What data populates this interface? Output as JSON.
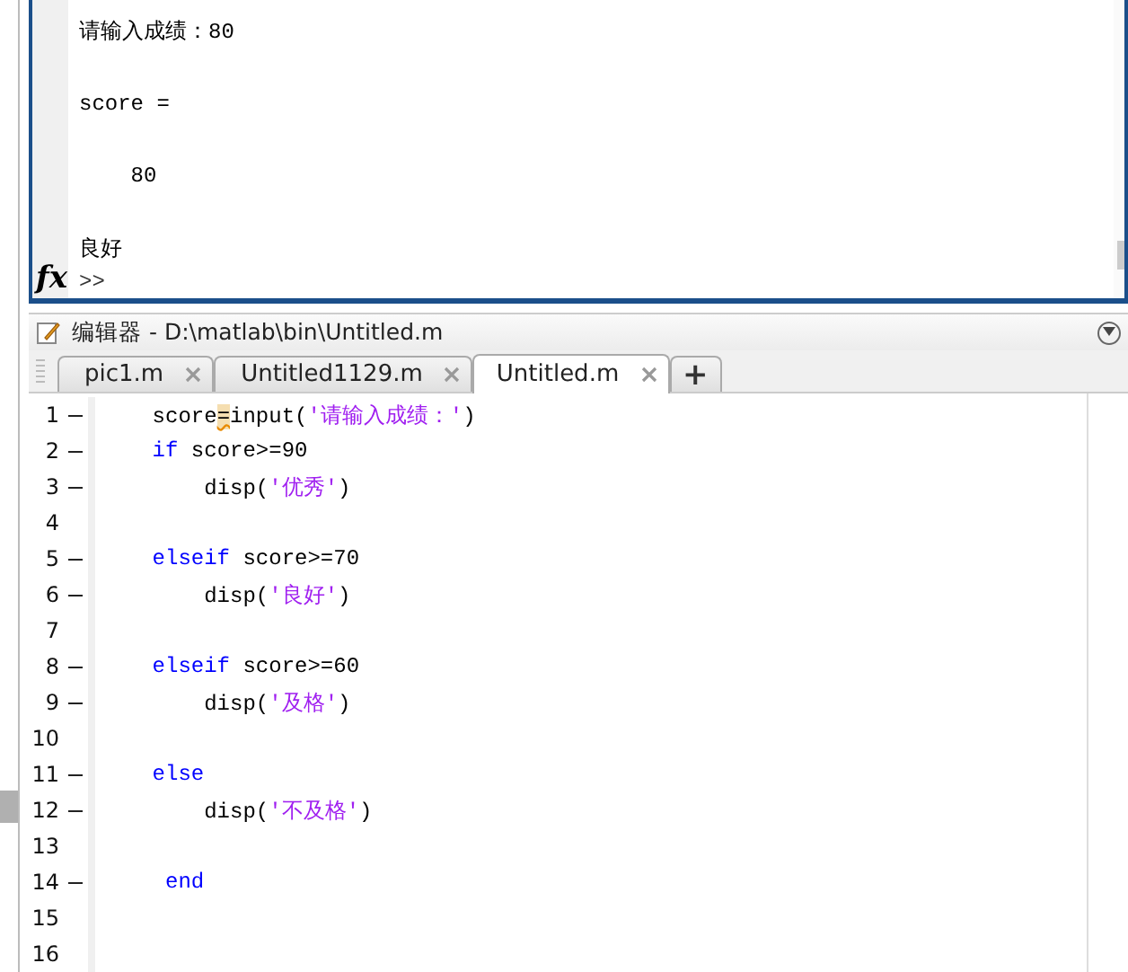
{
  "command_window": {
    "lines": [
      "请输入成绩：80",
      "score =",
      "    80",
      "良好"
    ],
    "fx_label": "fx",
    "prompt": ">>"
  },
  "editor": {
    "title": "编辑器 - D:\\matlab\\bin\\Untitled.m",
    "tabs": [
      {
        "label": "pic1.m",
        "selected": false
      },
      {
        "label": "Untitled1129.m",
        "selected": false
      },
      {
        "label": "Untitled.m",
        "selected": true
      }
    ],
    "new_tab": "+",
    "lines": [
      {
        "number": "1",
        "executable": true,
        "tokens": [
          {
            "kind": "plain",
            "text": "    score"
          },
          {
            "kind": "highlight",
            "text": "="
          },
          {
            "kind": "plain",
            "text": "input("
          },
          {
            "kind": "string",
            "text": "'请输入成绩：'"
          },
          {
            "kind": "plain",
            "text": ")"
          }
        ]
      },
      {
        "number": "2",
        "executable": true,
        "tokens": [
          {
            "kind": "keyword",
            "text": "    if"
          },
          {
            "kind": "plain",
            "text": " score>=90"
          }
        ]
      },
      {
        "number": "3",
        "executable": true,
        "tokens": [
          {
            "kind": "plain",
            "text": "        disp("
          },
          {
            "kind": "string",
            "text": "'优秀'"
          },
          {
            "kind": "plain",
            "text": ")"
          }
        ]
      },
      {
        "number": "4",
        "executable": false
      },
      {
        "number": "5",
        "executable": true,
        "tokens": [
          {
            "kind": "keyword",
            "text": "    elseif"
          },
          {
            "kind": "plain",
            "text": " score>=70"
          }
        ]
      },
      {
        "number": "6",
        "executable": true,
        "tokens": [
          {
            "kind": "plain",
            "text": "        disp("
          },
          {
            "kind": "string",
            "text": "'良好'"
          },
          {
            "kind": "plain",
            "text": ")"
          }
        ]
      },
      {
        "number": "7",
        "executable": false
      },
      {
        "number": "8",
        "executable": true,
        "tokens": [
          {
            "kind": "keyword",
            "text": "    elseif"
          },
          {
            "kind": "plain",
            "text": " score>=60"
          }
        ]
      },
      {
        "number": "9",
        "executable": true,
        "tokens": [
          {
            "kind": "plain",
            "text": "        disp("
          },
          {
            "kind": "string",
            "text": "'及格'"
          },
          {
            "kind": "plain",
            "text": ")"
          }
        ]
      },
      {
        "number": "10",
        "executable": false
      },
      {
        "number": "11",
        "executable": true,
        "tokens": [
          {
            "kind": "keyword",
            "text": "    else"
          }
        ]
      },
      {
        "number": "12",
        "executable": true,
        "tokens": [
          {
            "kind": "plain",
            "text": "        disp("
          },
          {
            "kind": "string",
            "text": "'不及格'"
          },
          {
            "kind": "plain",
            "text": ")"
          }
        ]
      },
      {
        "number": "13",
        "executable": false
      },
      {
        "number": "14",
        "executable": true,
        "tokens": [
          {
            "kind": "keyword",
            "text": "     end"
          }
        ]
      },
      {
        "number": "15",
        "executable": false
      },
      {
        "number": "16",
        "executable": false
      }
    ]
  }
}
